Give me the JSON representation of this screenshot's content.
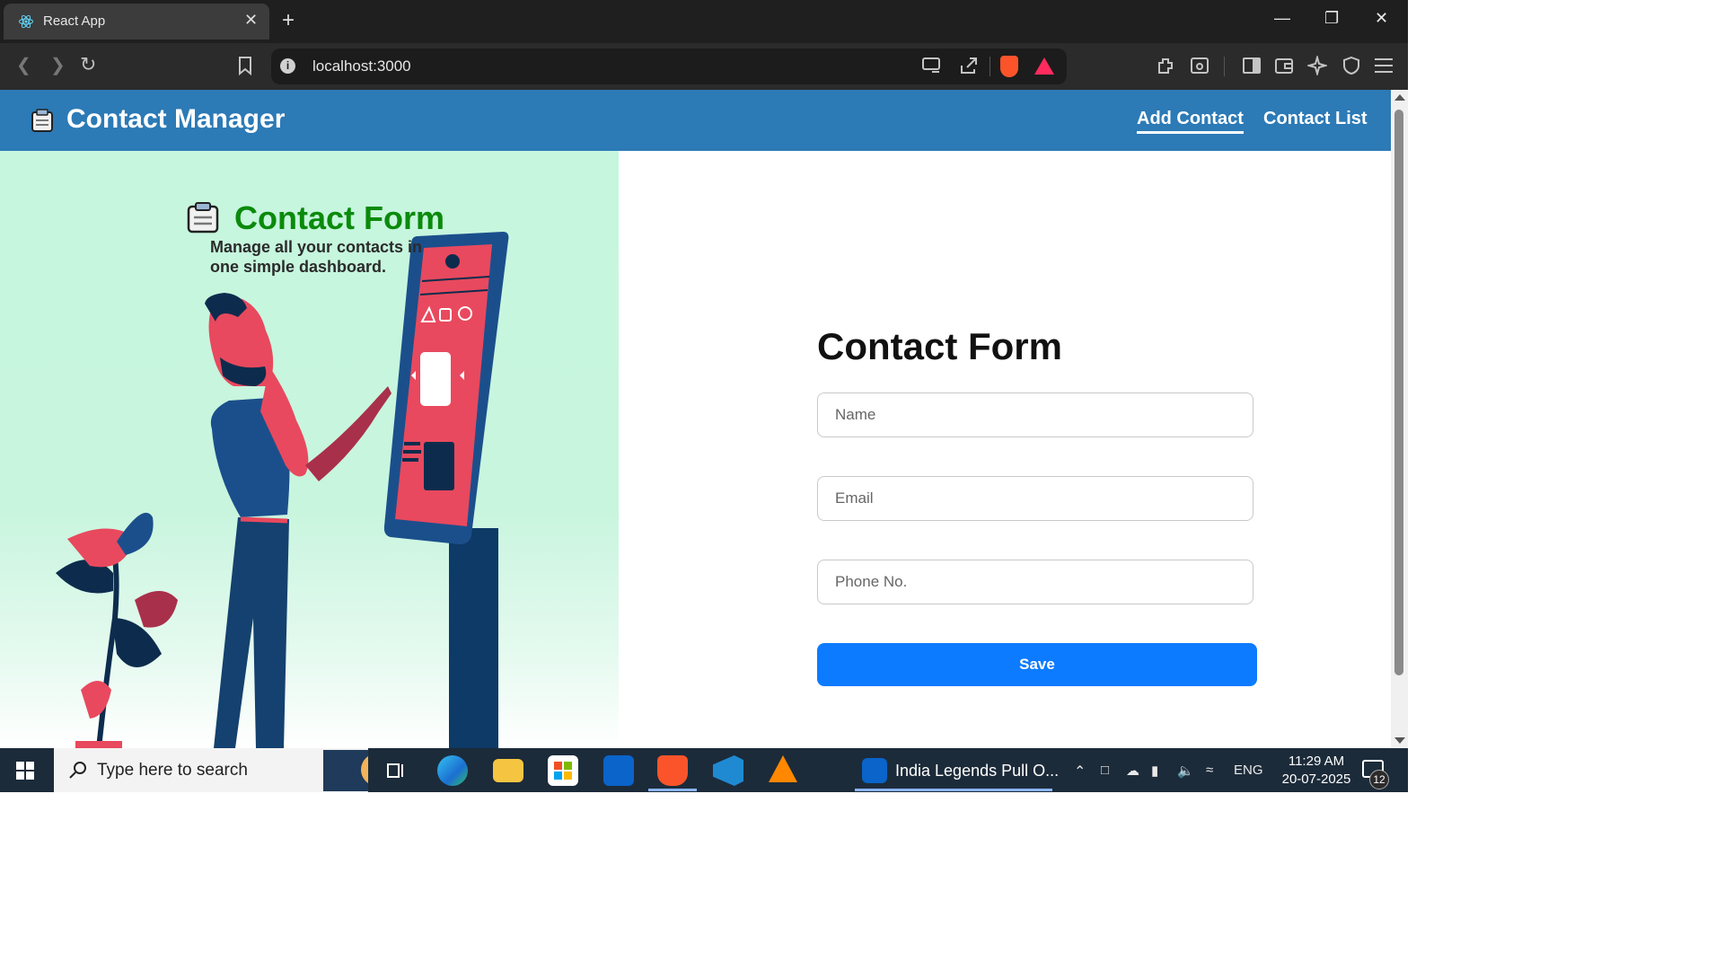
{
  "browser": {
    "tab_title": "React App",
    "tab_close": "✕",
    "new_tab": "+",
    "url": "localhost:3000",
    "window_controls": {
      "minimize": "—",
      "restore": "❐",
      "close": "✕"
    },
    "icons": [
      "back-icon",
      "forward-icon",
      "reload-icon",
      "bookmark-icon",
      "site-info-icon",
      "cast-icon",
      "share-icon",
      "brave-shields-icon",
      "brave-rewards-icon",
      "extensions-icon",
      "reader-icon",
      "sidebar-icon",
      "wallet-icon",
      "leo-ai-icon",
      "vpn-icon",
      "menu-icon"
    ]
  },
  "navbar": {
    "brand": "Contact Manager",
    "links": [
      {
        "label": "Add Contact",
        "active": true
      },
      {
        "label": "Contact List",
        "active": false
      }
    ]
  },
  "hero": {
    "title": "Contact Form",
    "subtitle": "Manage all your contacts in one simple dashboard."
  },
  "form": {
    "title": "Contact Form",
    "name_placeholder": "Name",
    "email_placeholder": "Email",
    "phone_placeholder": "Phone No.",
    "save_label": "Save"
  },
  "colors": {
    "navbar": "#2c7ab6",
    "hero_title": "#0b8a0b",
    "save_button": "#0d7bff",
    "left_panel": "#c6f6de"
  },
  "taskbar": {
    "search_placeholder": "Type here to search",
    "active_window": "India Legends Pull O...",
    "language": "ENG",
    "time": "11:29 AM",
    "date": "20-07-2025",
    "notification_count": "12"
  }
}
